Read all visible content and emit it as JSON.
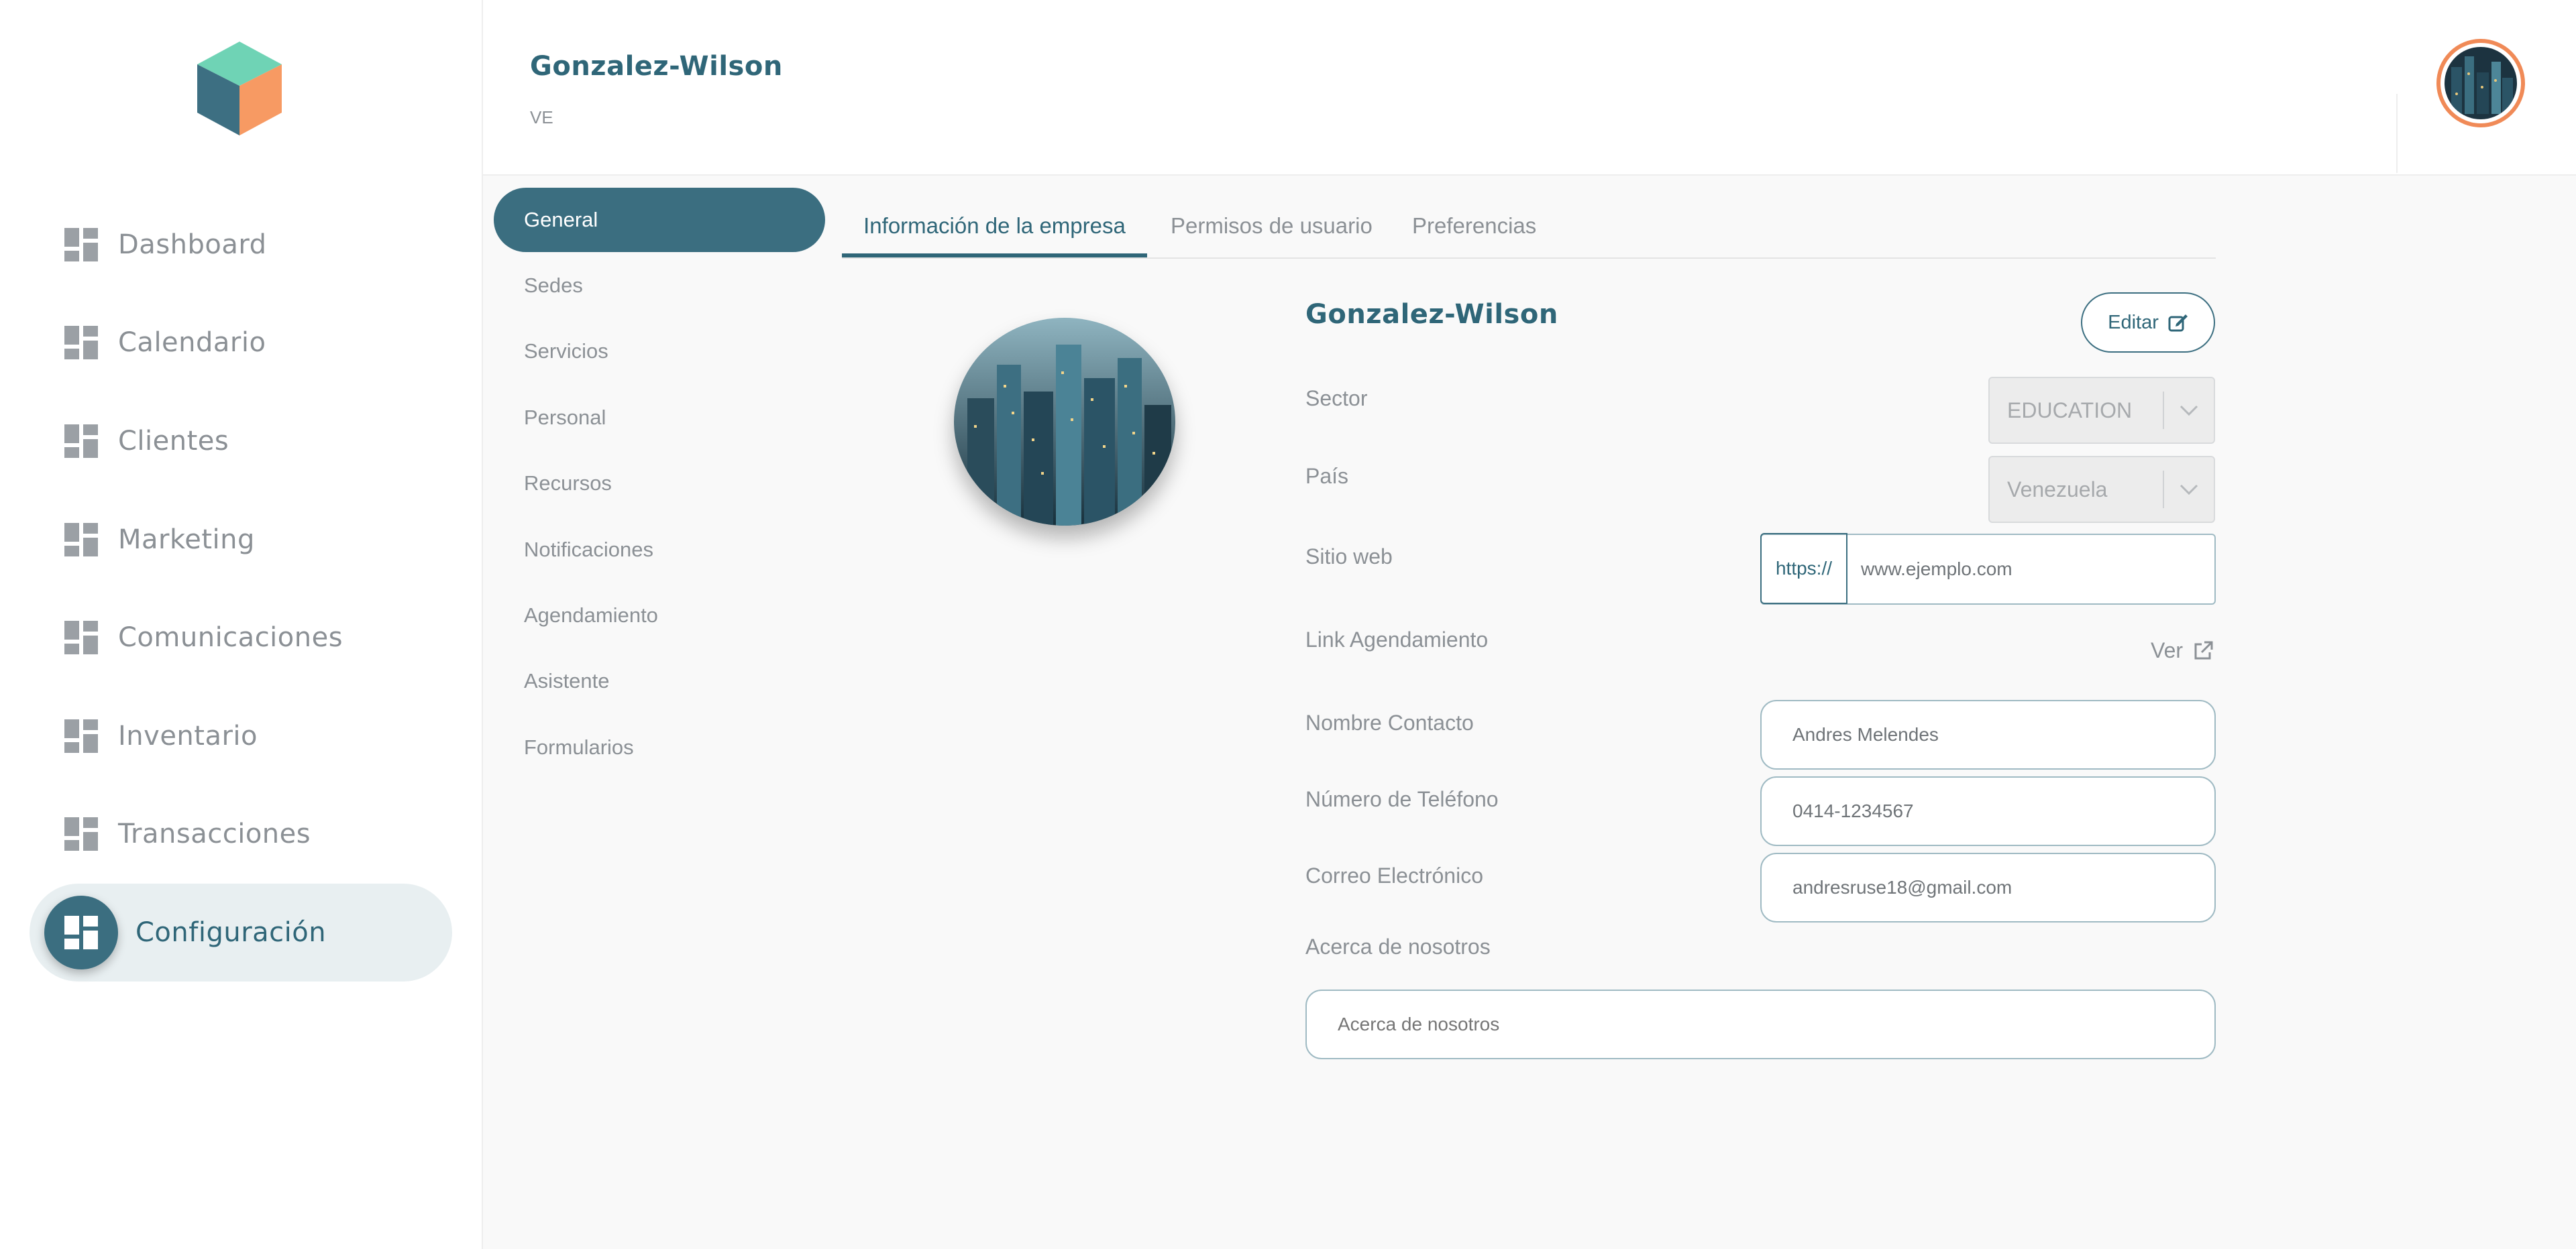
{
  "sidebar": {
    "items": [
      {
        "label": "Dashboard",
        "icon": "grid-icon"
      },
      {
        "label": "Calendario",
        "icon": "grid-icon"
      },
      {
        "label": "Clientes",
        "icon": "grid-icon"
      },
      {
        "label": "Marketing",
        "icon": "grid-icon"
      },
      {
        "label": "Comunicaciones",
        "icon": "grid-icon"
      },
      {
        "label": "Inventario",
        "icon": "grid-icon"
      },
      {
        "label": "Transacciones",
        "icon": "grid-icon"
      },
      {
        "label": "Configuración",
        "icon": "grid-icon",
        "active": true
      }
    ]
  },
  "header": {
    "company_name": "Gonzalez-Wilson",
    "country_code": "VE"
  },
  "settings_nav": {
    "items": [
      {
        "label": "General",
        "active": true
      },
      {
        "label": "Sedes"
      },
      {
        "label": "Servicios"
      },
      {
        "label": "Personal"
      },
      {
        "label": "Recursos"
      },
      {
        "label": "Notificaciones"
      },
      {
        "label": "Agendamiento"
      },
      {
        "label": "Asistente"
      },
      {
        "label": "Formularios"
      }
    ]
  },
  "tabs": [
    {
      "label": "Información de la empresa",
      "active": true
    },
    {
      "label": "Permisos de usuario"
    },
    {
      "label": "Preferencias"
    }
  ],
  "form": {
    "title": "Gonzalez-Wilson",
    "edit_label": "Editar",
    "sector": {
      "label": "Sector",
      "value": "EDUCATION"
    },
    "pais": {
      "label": "País",
      "value": "Venezuela"
    },
    "website": {
      "label": "Sitio web",
      "prefix": "https://",
      "value": "www.ejemplo.com"
    },
    "link": {
      "label": "Link Agendamiento",
      "action": "Ver"
    },
    "contact": {
      "label": "Nombre Contacto",
      "value": "Andres Melendes"
    },
    "phone": {
      "label": "Número de Teléfono",
      "value": "0414-1234567"
    },
    "email": {
      "label": "Correo Electrónico",
      "value": "andresruse18@gmail.com"
    },
    "about": {
      "label": "Acerca de nosotros",
      "placeholder": "Acerca de nosotros"
    }
  },
  "colors": {
    "primary": "#3b6e80",
    "title": "#2f6678",
    "accent_orange": "#f08a57",
    "logo_teal": "#6fd3b5",
    "logo_dark": "#3d6f82"
  }
}
